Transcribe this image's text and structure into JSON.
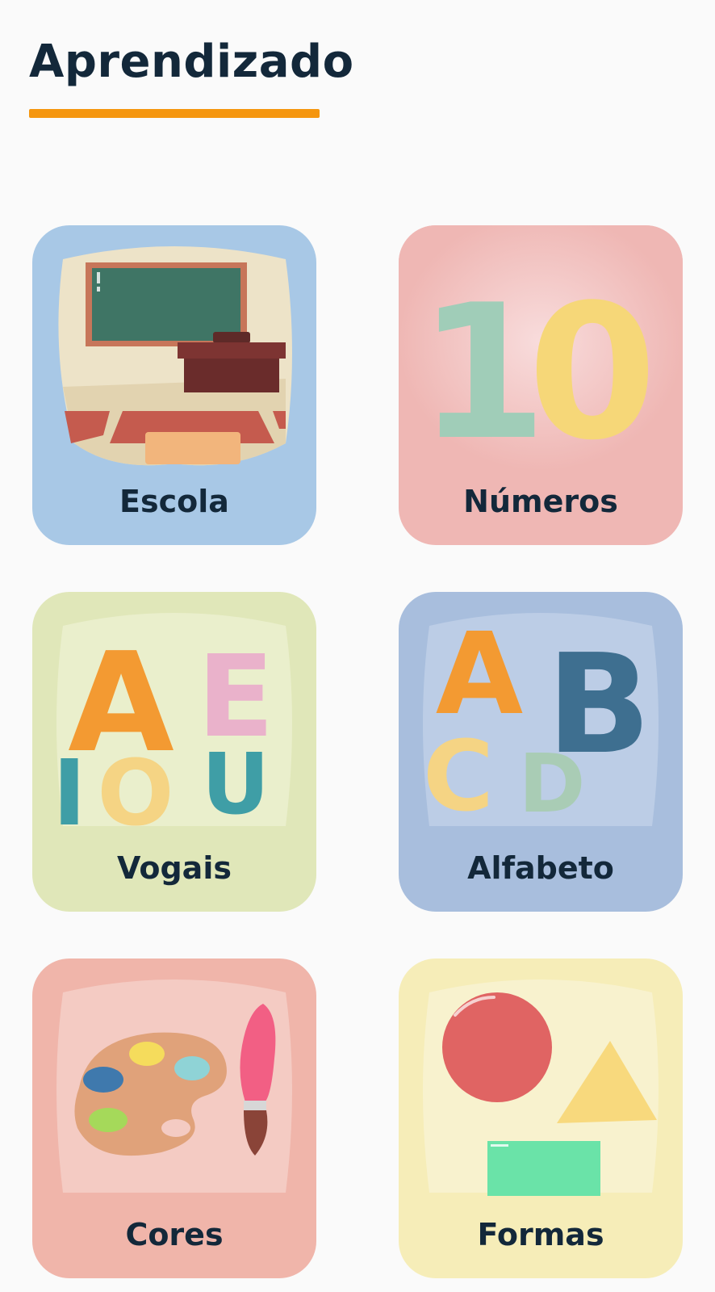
{
  "header": {
    "title": "Aprendizado"
  },
  "colors": {
    "title_text": "#13283a",
    "underline": "#f5960f",
    "card_escola_bg": "#a8c8e6",
    "card_numeros_bg": "#efb7b4",
    "card_vogais_bg": "#e0e7b9",
    "card_alfabeto_bg": "#a8bedd",
    "card_cores_bg": "#f0b5aa",
    "card_formas_bg": "#f6edb8"
  },
  "cards": [
    {
      "label": "Escola",
      "icon": "classroom-icon"
    },
    {
      "label": "Números",
      "icon": "numbers-icon",
      "art_text": [
        "1",
        "0"
      ]
    },
    {
      "label": "Vogais",
      "icon": "vowels-icon",
      "art_text": [
        "A",
        "E",
        "I",
        "O",
        "U"
      ]
    },
    {
      "label": "Alfabeto",
      "icon": "alphabet-icon",
      "art_text": [
        "A",
        "B",
        "C",
        "D"
      ]
    },
    {
      "label": "Cores",
      "icon": "paint-palette-icon"
    },
    {
      "label": "Formas",
      "icon": "shapes-icon"
    }
  ]
}
